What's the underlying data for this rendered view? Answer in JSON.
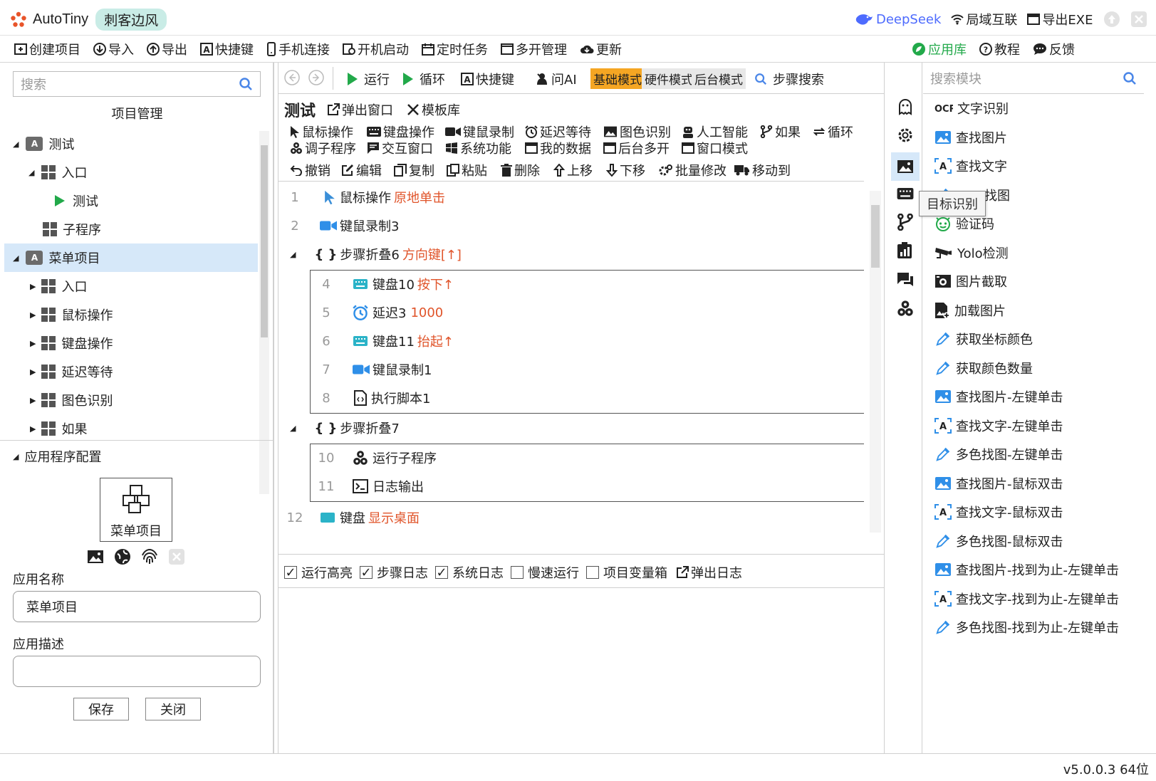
{
  "app": {
    "title": "AutoTiny",
    "badge": "刺客边风"
  },
  "titlebar": {
    "deepseek": "DeepSeek",
    "lan": "局域互联",
    "export_exe": "导出EXE"
  },
  "menu": [
    "创建项目",
    "导入",
    "导出",
    "快捷键",
    "手机连接",
    "开机启动",
    "定时任务",
    "多开管理",
    "更新"
  ],
  "menu_right": {
    "app_store": "应用库",
    "tutorial": "教程",
    "feedback": "反馈"
  },
  "left": {
    "search_placeholder": "搜索",
    "title": "项目管理",
    "tree": {
      "test": "测试",
      "entry": "入口",
      "test_run": "测试",
      "subprogram": "子程序",
      "menu_project": "菜单项目",
      "m_entry": "入口",
      "m_mouse": "鼠标操作",
      "m_keyboard": "键盘操作",
      "m_delay": "延迟等待",
      "m_color": "图色识别",
      "m_if": "如果"
    },
    "config_title": "应用程序配置",
    "app_card_name": "菜单项目",
    "name_label": "应用名称",
    "name_value": "菜单项目",
    "desc_label": "应用描述",
    "desc_value": "",
    "save": "保存",
    "close": "关闭"
  },
  "center": {
    "toolbar": {
      "run": "运行",
      "loop": "循环",
      "hotkey": "快捷键",
      "ai": "问AI",
      "mode_basic": "基础模式",
      "mode_hw": "硬件模式",
      "mode_bg": "后台模式",
      "step_search": "步骤搜索"
    },
    "header": {
      "title": "测试",
      "popup": "弹出窗口",
      "templates": "模板库"
    },
    "categories": {
      "mouse": "鼠标操作",
      "keyboard": "键盘操作",
      "record": "键鼠录制",
      "delay": "延迟等待",
      "color": "图色识别",
      "ai": "人工智能",
      "if": "如果",
      "loop": "循环",
      "call": "调子程序",
      "dialog": "交互窗口",
      "system": "系统功能",
      "mydata": "我的数据",
      "bgmulti": "后台多开",
      "window": "窗口模式"
    },
    "edit": {
      "undo": "撤销",
      "edit": "编辑",
      "copy": "复制",
      "paste": "粘贴",
      "delete": "删除",
      "up": "上移",
      "down": "下移",
      "batch": "批量修改",
      "move": "移动到"
    },
    "steps": {
      "s1": {
        "no": "1",
        "name": "鼠标操作",
        "arg": "原地单击"
      },
      "s2": {
        "no": "2",
        "name": "键鼠录制3"
      },
      "f6": {
        "name": "步骤折叠6",
        "arg": "方向键[↑]"
      },
      "s4": {
        "no": "4",
        "name": "键盘10",
        "arg": "按下↑"
      },
      "s5": {
        "no": "5",
        "name": "延迟3",
        "arg": "1000"
      },
      "s6": {
        "no": "6",
        "name": "键盘11",
        "arg": "抬起↑"
      },
      "s7": {
        "no": "7",
        "name": "键鼠录制1"
      },
      "s8": {
        "no": "8",
        "name": "执行脚本1"
      },
      "f7": {
        "name": "步骤折叠7"
      },
      "s10": {
        "no": "10",
        "name": "运行子程序"
      },
      "s11": {
        "no": "11",
        "name": "日志输出"
      },
      "s12": {
        "no": "12",
        "name": "键盘",
        "arg": "显示桌面"
      }
    },
    "options": {
      "highlight": "运行高亮",
      "step_log": "步骤日志",
      "sys_log": "系统日志",
      "slow": "慢速运行",
      "var_box": "项目变量箱",
      "popup_log": "弹出日志"
    }
  },
  "right": {
    "search_placeholder": "搜索模块",
    "tooltip": "目标识别",
    "modules": [
      "文字识别",
      "查找图片",
      "查找文字",
      "找图",
      "验证码",
      "Yolo检测",
      "图片截取",
      "加载图片",
      "获取坐标颜色",
      "获取颜色数量",
      "查找图片-左键单击",
      "查找文字-左键单击",
      "多色找图-左键单击",
      "查找图片-鼠标双击",
      "查找文字-鼠标双击",
      "多色找图-鼠标双击",
      "查找图片-找到为止-左键单击",
      "查找文字-找到为止-左键单击",
      "多色找图-找到为止-左键单击"
    ]
  },
  "status": {
    "version": "v5.0.0.3 64位"
  },
  "colors": {
    "accent_green": "#22a94a",
    "brand_orange": "#e8542a",
    "mode_orange": "#f5a623",
    "selection": "#d6e8f9",
    "teal": "#2bb3c8",
    "blue": "#2f8fe8"
  }
}
